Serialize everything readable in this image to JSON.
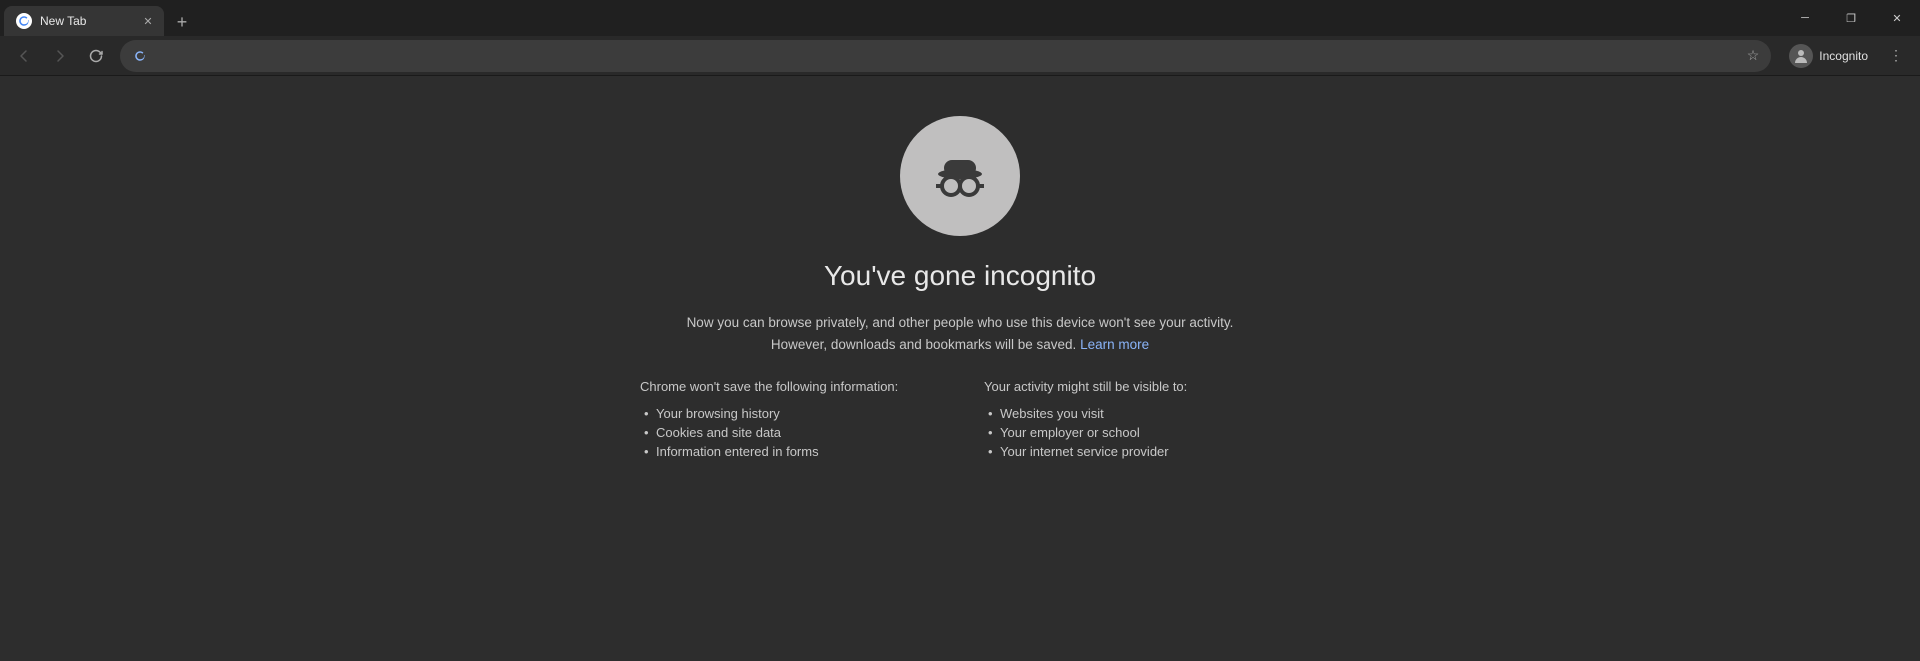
{
  "titlebar": {
    "tab_title": "New Tab",
    "new_tab_label": "+",
    "window_controls": {
      "minimize": "─",
      "maximize": "❐",
      "close": "✕"
    }
  },
  "toolbar": {
    "back_label": "←",
    "forward_label": "→",
    "refresh_label": "↻",
    "address_value": "",
    "bookmark_label": "☆",
    "incognito_label": "Incognito",
    "menu_label": "⋮"
  },
  "incognito_page": {
    "heading": "You've gone incognito",
    "description_part1": "Now you can browse privately, and other people who use this device won't see your activity. However, downloads and bookmarks will be saved.",
    "learn_more_text": "Learn more",
    "left_column_title": "Chrome won't save the following information:",
    "left_items": [
      "Your browsing history",
      "Cookies and site data",
      "Information entered in forms"
    ],
    "right_column_title": "Your activity might still be visible to:",
    "right_items": [
      "Websites you visit",
      "Your employer or school",
      "Your internet service provider"
    ]
  },
  "colors": {
    "background": "#2d2d2d",
    "titlebar_bg": "#202020",
    "toolbar_bg": "#292929",
    "tab_bg": "#353535",
    "address_bar_bg": "#3c3c3c",
    "text_primary": "#e8e8e8",
    "text_secondary": "#c8c8c8",
    "link_color": "#8ab4f8",
    "incognito_circle": "#c0bfbf"
  }
}
